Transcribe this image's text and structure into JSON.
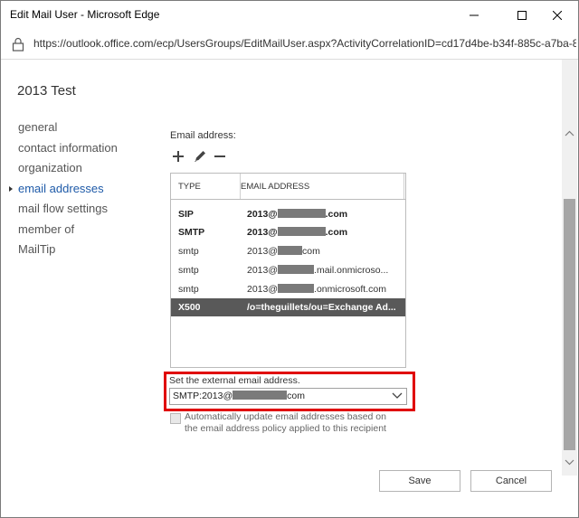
{
  "window": {
    "title": "Edit Mail User - Microsoft Edge"
  },
  "addressbar": {
    "url": "https://outlook.office.com/ecp/UsersGroups/EditMailUser.aspx?ActivityCorrelationID=cd17d4be-b34f-885c-a7ba-83"
  },
  "page": {
    "title": "2013 Test"
  },
  "nav": {
    "items": [
      {
        "label": "general"
      },
      {
        "label": "contact information"
      },
      {
        "label": "organization"
      },
      {
        "label": "email addresses",
        "active": true
      },
      {
        "label": "mail flow settings"
      },
      {
        "label": "member of"
      },
      {
        "label": "MailTip"
      }
    ]
  },
  "email": {
    "label": "Email address:",
    "toolbar": {
      "add": "plus-icon",
      "edit": "pencil-icon",
      "remove": "minus-icon"
    },
    "columns": {
      "type": "TYPE",
      "address": "EMAIL ADDRESS"
    },
    "rows": [
      {
        "type": "SIP",
        "prefix": "2013@",
        "suffix": ".com"
      },
      {
        "type": "SMTP",
        "prefix": "2013@",
        "suffix": ".com"
      },
      {
        "type": "smtp",
        "prefix": "2013@",
        "suffix": "com"
      },
      {
        "type": "smtp",
        "prefix": "2013@",
        "suffix": ".mail.onmicroso..."
      },
      {
        "type": "smtp",
        "prefix": "2013@",
        "suffix": ".onmicrosoft.com"
      },
      {
        "type": "X500",
        "address": "/o=theguillets/ou=Exchange Ad..."
      }
    ]
  },
  "external": {
    "label": "Set the external email address.",
    "value_prefix": "SMTP:2013@",
    "value_suffix": "com"
  },
  "auto_update": {
    "label": "Automatically update email addresses based on the email address policy applied to this recipient",
    "checked": false
  },
  "buttons": {
    "save": "Save",
    "cancel": "Cancel"
  },
  "colors": {
    "accent": "#1e5aa8",
    "highlight": "#e00000",
    "selected_row": "#595959"
  }
}
